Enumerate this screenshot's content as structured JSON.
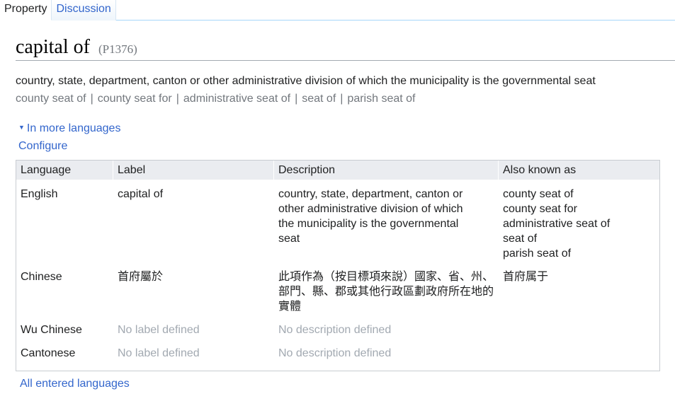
{
  "tabs": [
    {
      "label": "Property"
    },
    {
      "label": "Discussion"
    }
  ],
  "entity": {
    "label": "capital of",
    "id": "(P1376)",
    "description": "country, state, department, canton or other administrative division of which the municipality is the governmental seat",
    "aliases": [
      "county seat of",
      "county seat for",
      "administrative seat of",
      "seat of",
      "parish seat of"
    ]
  },
  "links": {
    "more_languages": "In more languages",
    "configure": "Configure",
    "all_languages": "All entered languages"
  },
  "table": {
    "headers": [
      "Language",
      "Label",
      "Description",
      "Also known as"
    ],
    "rows": [
      {
        "language": "English",
        "label": "capital of",
        "description": [
          "country, state, department, canton or",
          "other administrative division of which",
          "the municipality is the governmental",
          "seat"
        ],
        "aliases": [
          "county seat of",
          "county seat for",
          "administrative seat of",
          "seat of",
          "parish seat of"
        ]
      },
      {
        "language": "Chinese",
        "label": "首府屬於",
        "description": [
          "此項作為（按目標項來說）國家、省、州、",
          "部門、縣、郡或其他行政區劃政府所在地的",
          "實體"
        ],
        "aliases": [
          "首府属于"
        ]
      },
      {
        "language": "Wu Chinese",
        "label": "No label defined",
        "description": [
          "No description defined"
        ],
        "aliases": []
      },
      {
        "language": "Cantonese",
        "label": "No label defined",
        "description": [
          "No description defined"
        ],
        "aliases": []
      }
    ]
  }
}
